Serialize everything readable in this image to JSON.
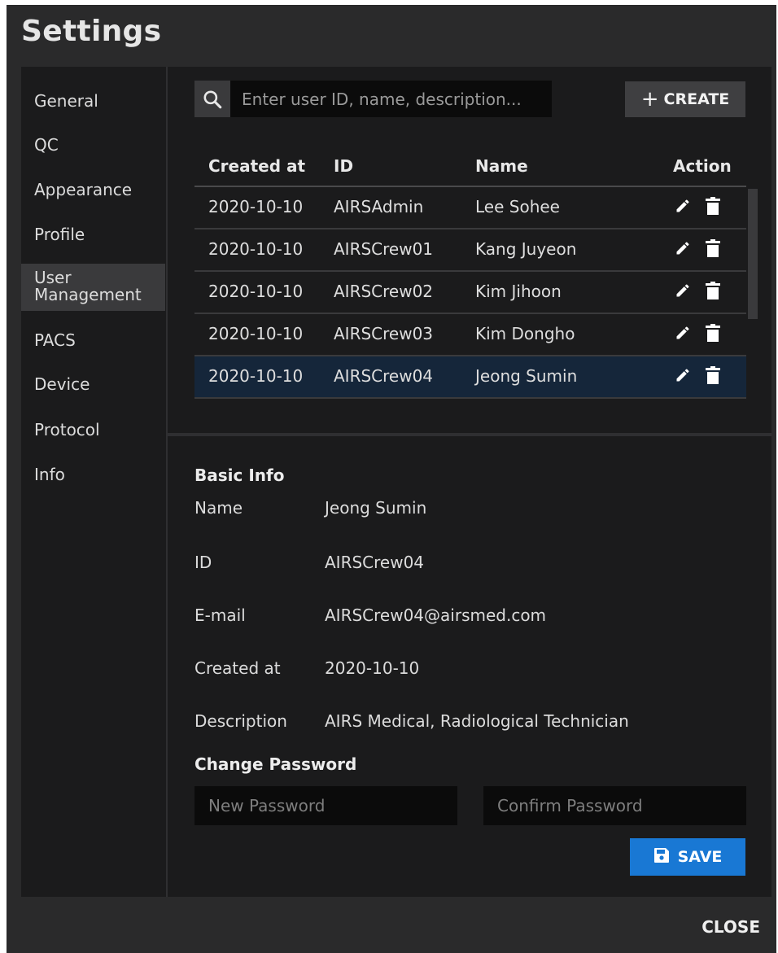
{
  "dialog": {
    "title": "Settings",
    "close_label": "CLOSE"
  },
  "sidebar": {
    "items": [
      {
        "label": "General"
      },
      {
        "label": "QC"
      },
      {
        "label": "Appearance"
      },
      {
        "label": "Profile"
      },
      {
        "label": "User\nManagement",
        "active": true
      },
      {
        "label": "PACS"
      },
      {
        "label": "Device"
      },
      {
        "label": "Protocol"
      },
      {
        "label": "Info"
      }
    ]
  },
  "users": {
    "search_placeholder": "Enter user ID, name, description...",
    "search_icon": "search-icon",
    "create_label": "CREATE",
    "columns": [
      "Created at",
      "ID",
      "Name",
      "Action"
    ],
    "rows": [
      {
        "created": "2020-10-10",
        "id": "AIRSAdmin",
        "name": "Lee Sohee"
      },
      {
        "created": "2020-10-10",
        "id": "AIRSCrew01",
        "name": "Kang Juyeon"
      },
      {
        "created": "2020-10-10",
        "id": "AIRSCrew02",
        "name": "Kim Jihoon"
      },
      {
        "created": "2020-10-10",
        "id": "AIRSCrew03",
        "name": "Kim Dongho"
      },
      {
        "created": "2020-10-10",
        "id": "AIRSCrew04",
        "name": "Jeong Sumin",
        "selected": true
      }
    ],
    "action_icons": [
      "pencil-icon",
      "trash-icon"
    ]
  },
  "detail": {
    "basic_info_title": "Basic Info",
    "fields": [
      {
        "label": "Name",
        "value": "Jeong Sumin"
      },
      {
        "label": "ID",
        "value": "AIRSCrew04"
      },
      {
        "label": "E-mail",
        "value": "AIRSCrew04@airsmed.com"
      },
      {
        "label": "Created at",
        "value": "2020-10-10"
      },
      {
        "label": "Description",
        "value": "AIRS Medical, Radiological Technician"
      }
    ],
    "change_password_title": "Change Password",
    "new_password_placeholder": "New Password",
    "confirm_password_placeholder": "Confirm Password",
    "save_label": "SAVE"
  },
  "colors": {
    "dialog_bg": "#2a2a2b",
    "panel_bg": "#1b1b1c",
    "selected_row": "#15263a",
    "save_button": "#1978d4"
  }
}
